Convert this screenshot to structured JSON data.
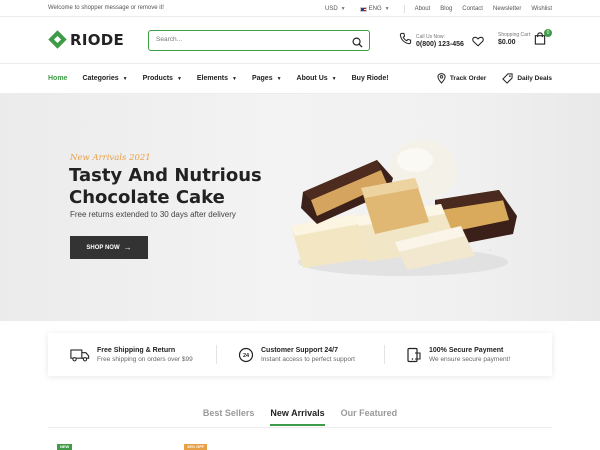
{
  "topbar": {
    "welcome": "Welcome to shopper message or remove it!",
    "currency": "USD",
    "language": "ENG",
    "links": [
      "About",
      "Blog",
      "Contact",
      "Newsletter",
      "Wishlist"
    ]
  },
  "header": {
    "logo": "RIODE",
    "search_placeholder": "Search...",
    "call_label": "Call Us Now:",
    "call_number": "0(800) 123-456",
    "cart_label": "Shopping Cart:",
    "cart_total": "$0.00",
    "cart_count": "0"
  },
  "nav": {
    "items": [
      {
        "label": "Home",
        "active": true,
        "dropdown": false
      },
      {
        "label": "Categories",
        "dropdown": true
      },
      {
        "label": "Products",
        "dropdown": true
      },
      {
        "label": "Elements",
        "dropdown": true
      },
      {
        "label": "Pages",
        "dropdown": true
      },
      {
        "label": "About Us",
        "dropdown": true
      },
      {
        "label": "Buy Riode!",
        "dropdown": false
      }
    ],
    "track_order": "Track Order",
    "daily_deals": "Daily Deals"
  },
  "hero": {
    "kicker": "New Arrivals 2021",
    "title_line1": "Tasty And Nutrious",
    "title_line2": "Chocolate Cake",
    "subtitle": "Free returns extended to 30 days after delivery",
    "button": "SHOP NOW"
  },
  "features": [
    {
      "title": "Free Shipping & Return",
      "subtitle": "Free shipping on orders over $99",
      "icon": "truck-icon"
    },
    {
      "title": "Customer Support 24/7",
      "subtitle": "Instant access to perfect support",
      "icon": "support-24-icon"
    },
    {
      "title": "100% Secure Payment",
      "subtitle": "We ensure secure payment!",
      "icon": "secure-payment-icon"
    }
  ],
  "tabs": [
    "Best Sellers",
    "New Arrivals",
    "Our Featured"
  ],
  "active_tab": "New Arrivals",
  "product_labels": [
    {
      "text": "NEW",
      "color": "#3f9b47"
    },
    {
      "text": "15% OFF",
      "color": "#e8a045"
    }
  ],
  "colors": {
    "accent": "#3f9b47",
    "kicker": "#e8a045",
    "button": "#333333"
  }
}
